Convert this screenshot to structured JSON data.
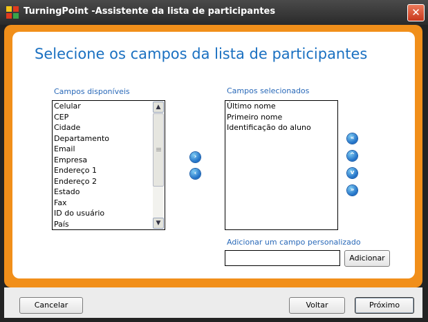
{
  "window": {
    "title": "TurningPoint -Assistente da lista de participantes"
  },
  "heading": "Selecione os campos da lista de participantes",
  "available": {
    "label": "Campos disponíveis",
    "items": [
      "Celular",
      "CEP",
      "Cidade",
      "Departamento",
      "Email",
      "Empresa",
      "Endereço 1",
      "Endereço 2",
      "Estado",
      "Fax",
      "ID do usuário",
      "País"
    ]
  },
  "selected": {
    "label": "Campos selecionados",
    "items": [
      "Último nome",
      "Primeiro nome",
      "Identificação do aluno"
    ]
  },
  "custom_field": {
    "label": "Adicionar um campo personalizado",
    "value": "",
    "add_label": "Adicionar"
  },
  "footer": {
    "cancel_label": "Cancelar",
    "back_label": "Voltar",
    "next_label": "Próximo"
  },
  "colors": {
    "accent_orange": "#f18f1a",
    "heading_blue": "#1a70c1",
    "label_blue": "#2868b8"
  }
}
